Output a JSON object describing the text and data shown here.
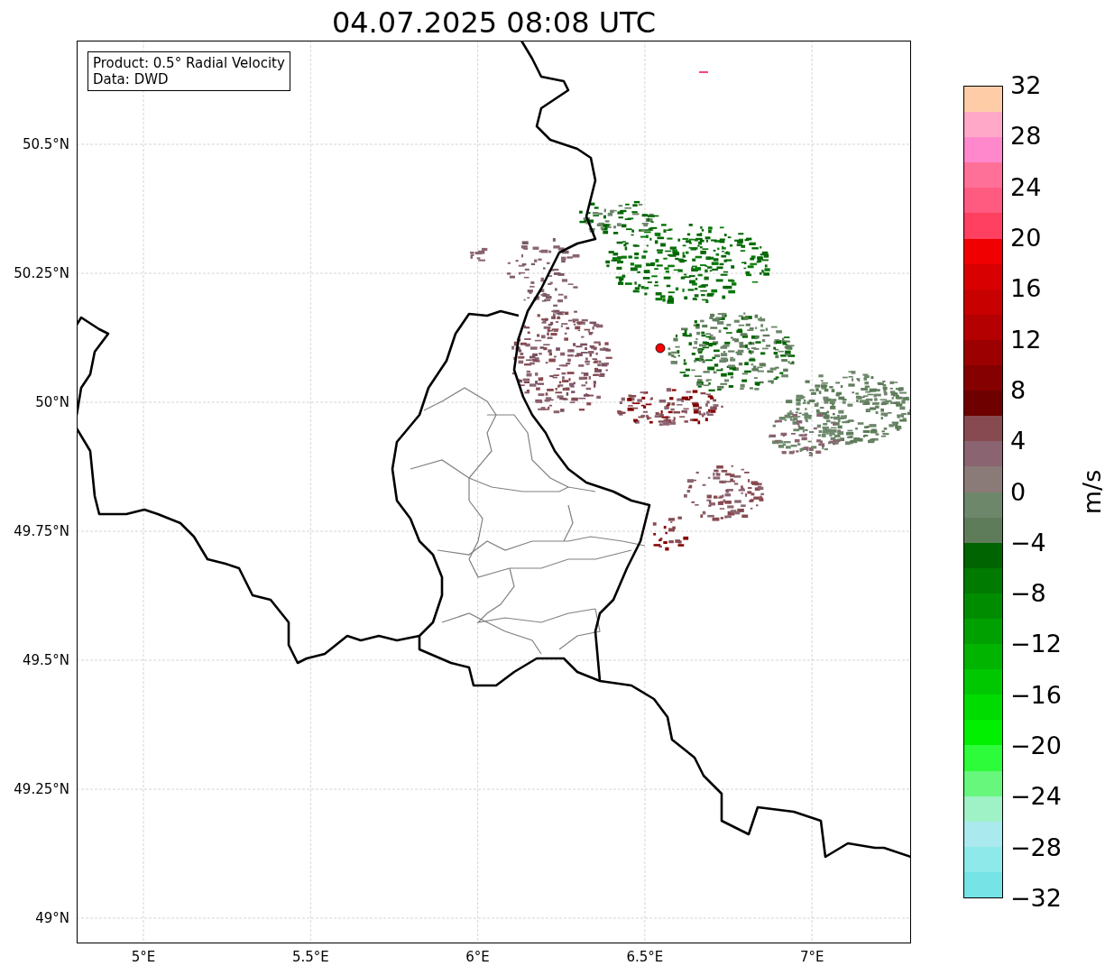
{
  "title": "04.07.2025 08:08 UTC",
  "info_box": {
    "lines": [
      "Product: 0.5° Radial Velocity",
      "Data: DWD"
    ]
  },
  "map": {
    "lat_labels": [
      "50.5°N",
      "50.25°N",
      "50°N",
      "49.75°N",
      "49.5°N",
      "49.25°N",
      "49°N"
    ],
    "lon_labels": [
      "5°E",
      "5.5°E",
      "6°E",
      "6.5°E",
      "7°E"
    ]
  },
  "colorbar": {
    "label": "m/s",
    "ticks": [
      "32",
      "28",
      "24",
      "20",
      "16",
      "12",
      "8",
      "4",
      "0",
      "−4",
      "−8",
      "−12",
      "−16",
      "−20",
      "−24",
      "−28",
      "−32"
    ],
    "bands": [
      {
        "color": "#ffcca8"
      },
      {
        "color": "#ffa8c8"
      },
      {
        "color": "#ff88cc"
      },
      {
        "color": "#ff7098"
      },
      {
        "color": "#ff5a80"
      },
      {
        "color": "#ff4060"
      },
      {
        "color": "#f00000"
      },
      {
        "color": "#d80000"
      },
      {
        "color": "#c80000"
      },
      {
        "color": "#b40000"
      },
      {
        "color": "#9c0000"
      },
      {
        "color": "#850000"
      },
      {
        "color": "#6e0000"
      },
      {
        "color": "#874a50"
      },
      {
        "color": "#8a6470"
      },
      {
        "color": "#8a7a78"
      },
      {
        "color": "#6d876b"
      },
      {
        "color": "#5e7c5a"
      },
      {
        "color": "#006400"
      },
      {
        "color": "#007a00"
      },
      {
        "color": "#008c00"
      },
      {
        "color": "#00a000"
      },
      {
        "color": "#00b400"
      },
      {
        "color": "#00c800"
      },
      {
        "color": "#00dc00"
      },
      {
        "color": "#00f000"
      },
      {
        "color": "#2dfc3a"
      },
      {
        "color": "#66f77c"
      },
      {
        "color": "#9ef2c6"
      },
      {
        "color": "#aae9ee"
      },
      {
        "color": "#8de9ea"
      },
      {
        "color": "#76e4e6"
      }
    ]
  }
}
